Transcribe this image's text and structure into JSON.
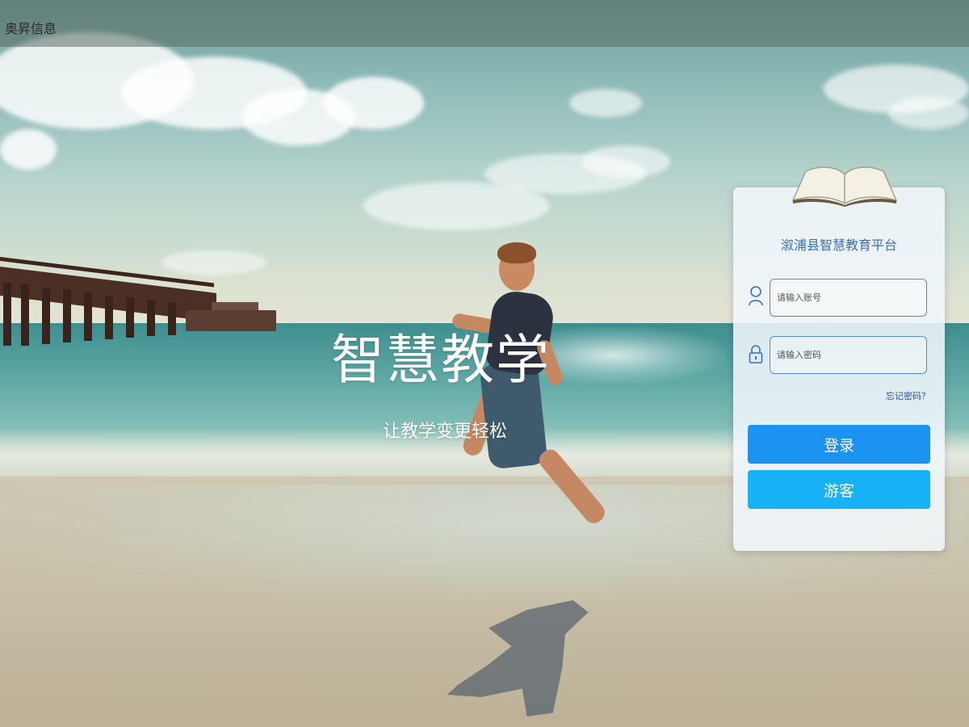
{
  "topbar": {
    "brand": "奥昇信息"
  },
  "hero": {
    "title": "智慧教学",
    "subtitle": "让教学变更轻松"
  },
  "login": {
    "title": "溆浦县智慧教育平台",
    "account_placeholder": "请输入账号",
    "password_placeholder": "请输入密码",
    "forgot": "忘记密码？",
    "login_button": "登录",
    "guest_button": "游客",
    "icons": {
      "account": "user-icon",
      "password": "lock-icon",
      "header": "open-book-icon"
    }
  },
  "colors": {
    "accent_blue": "#1a93f1",
    "guest_blue": "#16b2f5",
    "title_blue": "#3a70b8",
    "input_border": "#4f8ad8"
  }
}
